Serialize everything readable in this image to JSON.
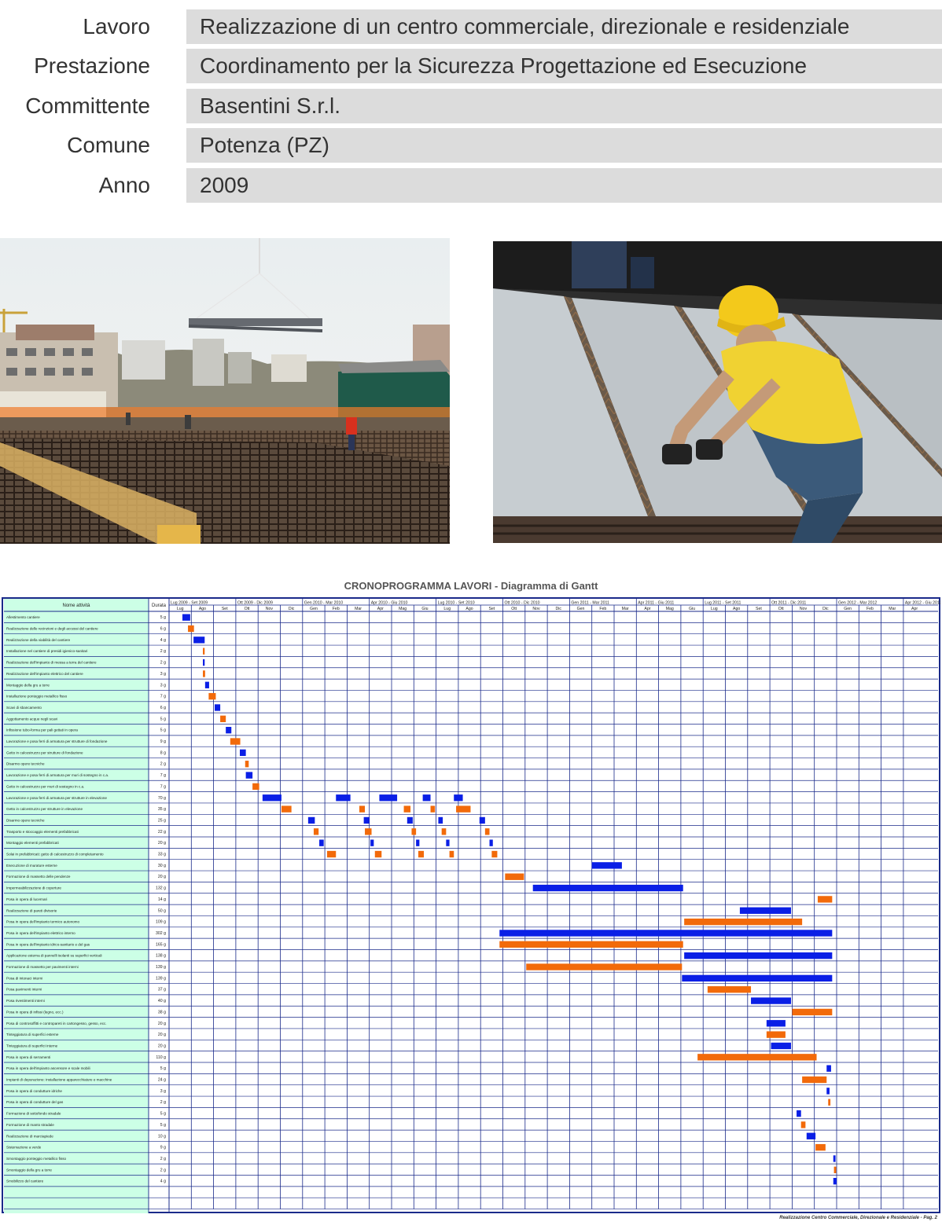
{
  "info": [
    {
      "label": "Lavoro",
      "value": "Realizzazione di un centro commerciale, direzionale e residenziale"
    },
    {
      "label": "Prestazione",
      "value": "Coordinamento per la Sicurezza  Progettazione ed Esecuzione"
    },
    {
      "label": "Committente",
      "value": "Basentini S.r.l."
    },
    {
      "label": "Comune",
      "value": "Potenza (PZ)"
    },
    {
      "label": "Anno",
      "value": "2009"
    }
  ],
  "gantt": {
    "title": "CRONOPROGRAMMA LAVORI - Diagramma di Gantt",
    "header_name": "Nome attività",
    "header_duration": "Durata",
    "footer": "Realizzazione Centro Commerciale, Direzionale e Residenziale - Pag. 2",
    "colors": {
      "blue": "#0a1fe6",
      "orange": "#f26a0a",
      "grid": "#1a2a8a",
      "name_bg": "#ccffe6"
    },
    "quarters": [
      "Lug 2009 - Set 2009",
      "Ott 2009 - Dic 2009",
      "Gen 2010 - Mar 2010",
      "Apr 2010 - Giu 2010",
      "Lug 2010 - Set 2010",
      "Ott 2010 - Dic 2010",
      "Gen 2011 - Mar 2011",
      "Apr 2011 - Giu 2011",
      "Lug 2011 - Set 2011",
      "Ott 2011 - Dic 2011",
      "Gen 2012 - Mar 2012",
      "Apr 2012 - Giu 2012"
    ],
    "months": [
      "Lug",
      "Ago",
      "Set",
      "Ott",
      "Nov",
      "Dic",
      "Gen",
      "Feb",
      "Mar",
      "Apr",
      "Mag",
      "Giu",
      "Lug",
      "Ago",
      "Set",
      "Ott",
      "Nov",
      "Dic",
      "Gen",
      "Feb",
      "Mar",
      "Apr",
      "Mag",
      "Giu",
      "Lug",
      "Ago",
      "Set",
      "Ott",
      "Nov",
      "Dic",
      "Gen",
      "Feb",
      "Mar",
      "Apr"
    ],
    "tasks": [
      {
        "name": "Allestimento cantiere",
        "duration": "5 g",
        "color": "blue",
        "bars": [
          [
            0.6,
            0.95
          ]
        ]
      },
      {
        "name": "Realizzazione delle recinzioni e degli accessi del cantiere",
        "duration": "6 g",
        "color": "orange",
        "bars": [
          [
            0.85,
            1.12
          ]
        ]
      },
      {
        "name": "Realizzazione della viabilità del cantiere",
        "duration": "4 g",
        "color": "blue",
        "bars": [
          [
            1.1,
            1.6
          ]
        ]
      },
      {
        "name": "Installazione nel cantiere di presidi igienico-sanitari",
        "duration": "2 g",
        "color": "orange",
        "bars": [
          [
            1.52,
            1.6
          ]
        ]
      },
      {
        "name": "Realizzazione dell'impianto di messa a terra del cantiere",
        "duration": "2 g",
        "color": "blue",
        "bars": [
          [
            1.52,
            1.6
          ]
        ]
      },
      {
        "name": "Realizzazione dell'impianto elettrico del cantiere",
        "duration": "3 g",
        "color": "orange",
        "bars": [
          [
            1.52,
            1.62
          ]
        ]
      },
      {
        "name": "Montaggio della gru a torre",
        "duration": "3 g",
        "color": "blue",
        "bars": [
          [
            1.62,
            1.8
          ]
        ]
      },
      {
        "name": "Installazione ponteggio metallico fisso",
        "duration": "7 g",
        "color": "orange",
        "bars": [
          [
            1.78,
            2.1
          ]
        ]
      },
      {
        "name": "Scavi di sbancamento",
        "duration": "6 g",
        "color": "blue",
        "bars": [
          [
            2.05,
            2.3
          ]
        ]
      },
      {
        "name": "Aggottamento acque negli scavi",
        "duration": "5 g",
        "color": "orange",
        "bars": [
          [
            2.3,
            2.55
          ]
        ]
      },
      {
        "name": "Infissione tubo-forma per pali gettati in opera",
        "duration": "5 g",
        "color": "blue",
        "bars": [
          [
            2.55,
            2.8
          ]
        ]
      },
      {
        "name": "Lavorazione e posa ferri di armatura per strutture di fondazione",
        "duration": "9 g",
        "color": "orange",
        "bars": [
          [
            2.75,
            3.2
          ]
        ]
      },
      {
        "name": "Getto in calcestruzzo per strutture di fondazione",
        "duration": "8 g",
        "color": "blue",
        "bars": [
          [
            3.18,
            3.45
          ]
        ]
      },
      {
        "name": "Disarmo opere tecniche",
        "duration": "2 g",
        "color": "orange",
        "bars": [
          [
            3.42,
            3.58
          ]
        ]
      },
      {
        "name": "Lavorazione e posa ferri di armatura per muri di sostegno in c.a.",
        "duration": "7 g",
        "color": "blue",
        "bars": [
          [
            3.45,
            3.75
          ]
        ]
      },
      {
        "name": "Getto in calcestruzzo per muri di sostegno in c.a.",
        "duration": "7 g",
        "color": "orange",
        "bars": [
          [
            3.75,
            4.05
          ]
        ]
      },
      {
        "name": "Lavorazione e posa ferri di armatura per strutture in elevazione",
        "duration": "70 g",
        "color": "blue",
        "bars": [
          [
            4.2,
            5.05
          ],
          [
            7.5,
            8.15
          ],
          [
            9.45,
            10.25
          ],
          [
            11.4,
            11.75
          ],
          [
            12.8,
            13.2
          ]
        ]
      },
      {
        "name": "Getto in calcestruzzo per strutture in elevazione",
        "duration": "35 g",
        "color": "orange",
        "bars": [
          [
            5.05,
            5.5
          ],
          [
            8.55,
            8.8
          ],
          [
            10.55,
            10.85
          ],
          [
            11.75,
            11.95
          ],
          [
            12.9,
            13.55
          ]
        ]
      },
      {
        "name": "Disarmo opere tecniche",
        "duration": "25 g",
        "color": "blue",
        "bars": [
          [
            6.25,
            6.55
          ],
          [
            8.75,
            9.0
          ],
          [
            10.7,
            10.95
          ],
          [
            12.1,
            12.3
          ],
          [
            13.95,
            14.2
          ]
        ]
      },
      {
        "name": "Trasporto e stoccaggio elementi prefabbricati",
        "duration": "22 g",
        "color": "orange",
        "bars": [
          [
            6.5,
            6.72
          ],
          [
            8.8,
            9.1
          ],
          [
            10.9,
            11.1
          ],
          [
            12.25,
            12.45
          ],
          [
            14.2,
            14.4
          ]
        ]
      },
      {
        "name": "Montaggio elementi prefabbricati",
        "duration": "20 g",
        "color": "blue",
        "bars": [
          [
            6.75,
            6.95
          ],
          [
            9.05,
            9.2
          ],
          [
            11.1,
            11.25
          ],
          [
            12.45,
            12.6
          ],
          [
            14.4,
            14.55
          ]
        ]
      },
      {
        "name": "Solai in prefabbricati: getto di calcestruzzo di completamento",
        "duration": "33 g",
        "color": "orange",
        "bars": [
          [
            7.1,
            7.5
          ],
          [
            9.25,
            9.55
          ],
          [
            11.2,
            11.45
          ],
          [
            12.6,
            12.8
          ],
          [
            14.5,
            14.75
          ]
        ]
      },
      {
        "name": "Esecuzione di murature esterne",
        "duration": "30 g",
        "color": "blue",
        "bars": [
          [
            19.0,
            20.35
          ]
        ]
      },
      {
        "name": "Formazione di massetto delle pendenze",
        "duration": "20 g",
        "color": "orange",
        "bars": [
          [
            15.1,
            15.95
          ]
        ]
      },
      {
        "name": "Impermeabilizzazione di coperture",
        "duration": "132 g",
        "color": "blue",
        "bars": [
          [
            16.35,
            23.1
          ]
        ]
      },
      {
        "name": "Posa in opera di lucernari",
        "duration": "14 g",
        "color": "orange",
        "bars": [
          [
            29.15,
            29.8
          ]
        ]
      },
      {
        "name": "Realizzazione di pareti divisorie",
        "duration": "50 g",
        "color": "blue",
        "bars": [
          [
            25.65,
            27.95
          ]
        ]
      },
      {
        "name": "Posa in opera dell'impianto termico autonomo",
        "duration": "109 g",
        "color": "orange",
        "bars": [
          [
            23.15,
            28.45
          ]
        ]
      },
      {
        "name": "Posa in opera dell'impianto elettrico interno",
        "duration": "302 g",
        "color": "blue",
        "bars": [
          [
            14.85,
            29.8
          ]
        ]
      },
      {
        "name": "Posa in opera dell'impianto idrico-sanitario e del gas",
        "duration": "165 g",
        "color": "orange",
        "bars": [
          [
            14.85,
            23.1
          ]
        ]
      },
      {
        "name": "Applicazione esterna di pannelli isolanti su superfici verticali",
        "duration": "138 g",
        "color": "blue",
        "bars": [
          [
            23.15,
            29.8
          ]
        ]
      },
      {
        "name": "Formazione di massetto per pavimenti interni",
        "duration": "139 g",
        "color": "orange",
        "bars": [
          [
            16.05,
            23.05
          ]
        ]
      },
      {
        "name": "Posa di intonaci interni",
        "duration": "139 g",
        "color": "blue",
        "bars": [
          [
            23.05,
            29.8
          ]
        ]
      },
      {
        "name": "Posa pavimenti interni",
        "duration": "37 g",
        "color": "orange",
        "bars": [
          [
            24.2,
            26.15
          ]
        ]
      },
      {
        "name": "Posa rivestimenti interni",
        "duration": "40 g",
        "color": "blue",
        "bars": [
          [
            26.15,
            27.95
          ]
        ]
      },
      {
        "name": "Posa in opera di infissi (legno, ecc.)",
        "duration": "38 g",
        "color": "orange",
        "bars": [
          [
            28.0,
            29.8
          ]
        ]
      },
      {
        "name": "Posa di controsoffitti e contropareti in cartongesso, gesso, ecc.",
        "duration": "20 g",
        "color": "blue",
        "bars": [
          [
            26.85,
            27.7
          ]
        ]
      },
      {
        "name": "Tinteggiatura di superfici esterne",
        "duration": "20 g",
        "color": "orange",
        "bars": [
          [
            26.85,
            27.7
          ]
        ]
      },
      {
        "name": "Tinteggiatura di superfici interne",
        "duration": "20 g",
        "color": "blue",
        "bars": [
          [
            27.05,
            27.95
          ]
        ]
      },
      {
        "name": "Posa in opera di serramenti",
        "duration": "110 g",
        "color": "orange",
        "bars": [
          [
            23.75,
            29.1
          ]
        ]
      },
      {
        "name": "Posa in opera dell'impianto ascensore e scale mobili",
        "duration": "5 g",
        "color": "blue",
        "bars": [
          [
            29.55,
            29.75
          ]
        ]
      },
      {
        "name": "Impianti di depurazione: installazione apparecchiature e macchine",
        "duration": "24 g",
        "color": "orange",
        "bars": [
          [
            28.45,
            29.55
          ]
        ]
      },
      {
        "name": "Posa in opera di condutture idriche",
        "duration": "3 g",
        "color": "blue",
        "bars": [
          [
            29.55,
            29.68
          ]
        ]
      },
      {
        "name": "Posa in opera di condutture del gas",
        "duration": "2 g",
        "color": "orange",
        "bars": [
          [
            29.62,
            29.72
          ]
        ]
      },
      {
        "name": "Formazione di sottofondo stradale",
        "duration": "5 g",
        "color": "blue",
        "bars": [
          [
            28.2,
            28.4
          ]
        ]
      },
      {
        "name": "Formazione di manto stradale",
        "duration": "5 g",
        "color": "orange",
        "bars": [
          [
            28.4,
            28.6
          ]
        ]
      },
      {
        "name": "Realizzazione di marciapiede",
        "duration": "10 g",
        "color": "blue",
        "bars": [
          [
            28.65,
            29.05
          ]
        ]
      },
      {
        "name": "Sistemazione a verde",
        "duration": "9 g",
        "color": "orange",
        "bars": [
          [
            29.05,
            29.5
          ]
        ]
      },
      {
        "name": "Smontaggio ponteggio metallico fisso",
        "duration": "2 g",
        "color": "blue",
        "bars": [
          [
            29.85,
            29.95
          ]
        ]
      },
      {
        "name": "Smontaggio della gru a torre",
        "duration": "2 g",
        "color": "orange",
        "bars": [
          [
            29.88,
            29.98
          ]
        ]
      },
      {
        "name": "Smobilizzo del cantiere",
        "duration": "4 g",
        "color": "blue",
        "bars": [
          [
            29.85,
            30.0
          ]
        ]
      }
    ]
  }
}
